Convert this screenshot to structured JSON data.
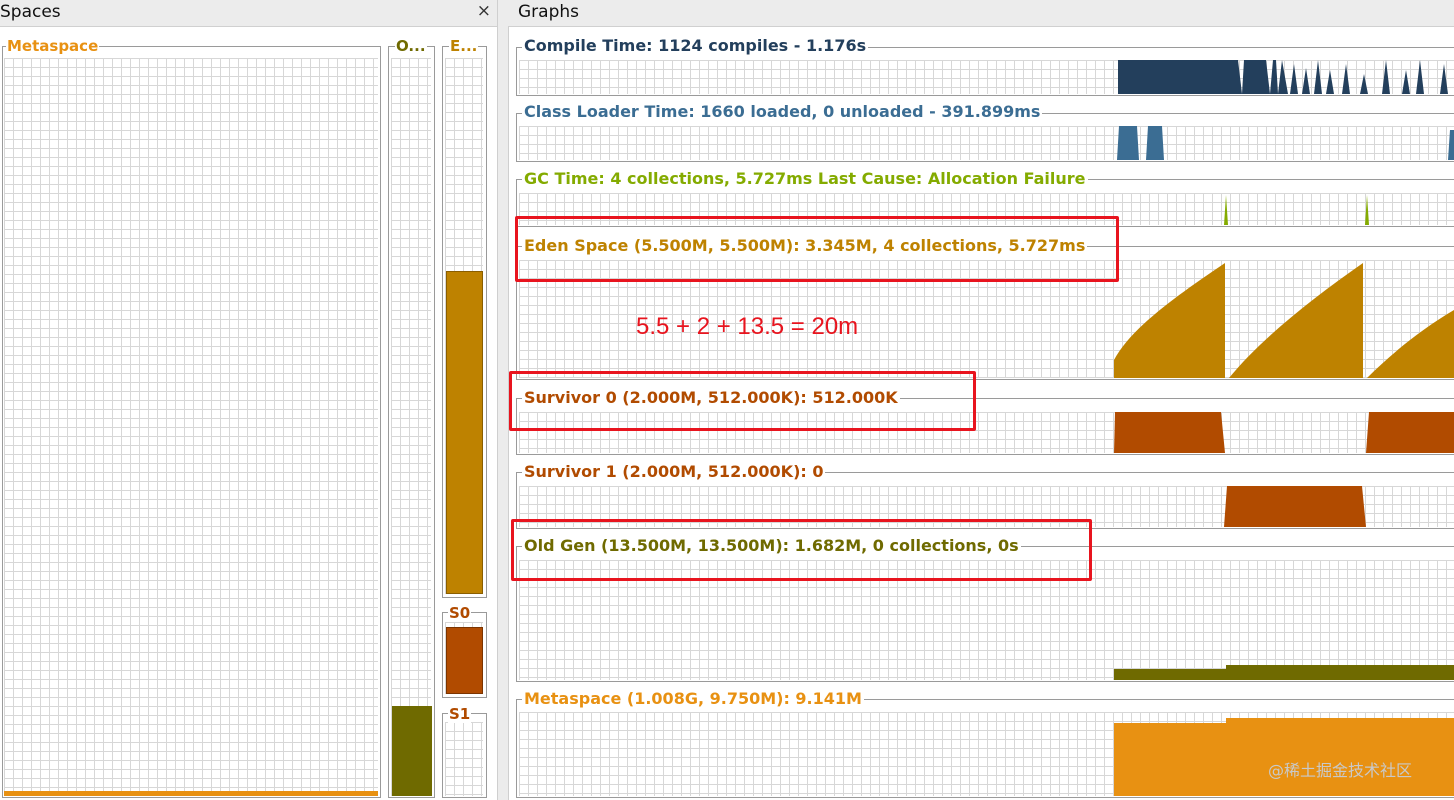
{
  "spaces": {
    "title": "Spaces",
    "close": "×",
    "metaspace": {
      "label": "Metaspace",
      "color": "#e89112",
      "used_fraction": 0.01
    },
    "old": {
      "label": "O...",
      "color": "#6f6a00",
      "used_fraction": 0.12
    },
    "eden": {
      "label": "E...",
      "color": "#be8200",
      "used_fraction": 0.61
    },
    "s0": {
      "label": "S0",
      "color": "#b14b00",
      "used_fraction": 1.0
    },
    "s1": {
      "label": "S1",
      "color": "#b14b00",
      "used_fraction": 0.0
    }
  },
  "graphs": {
    "title": "Graphs",
    "compile": {
      "label": "Compile Time: 1124 compiles - 1.176s",
      "color": "#233f5c"
    },
    "classloader": {
      "label": "Class Loader Time: 1660 loaded, 0 unloaded - 391.899ms",
      "color": "#3b6d93"
    },
    "gc": {
      "label": "GC Time: 4 collections, 5.727ms Last Cause: Allocation Failure",
      "color": "#84ab00"
    },
    "eden": {
      "label": "Eden Space (5.500M, 5.500M): 3.345M, 4 collections, 5.727ms",
      "color": "#be8200"
    },
    "survivor0": {
      "label": "Survivor 0 (2.000M, 512.000K): 512.000K",
      "color": "#b14b00"
    },
    "survivor1": {
      "label": "Survivor 1 (2.000M, 512.000K): 0",
      "color": "#b14b00"
    },
    "oldgen": {
      "label": "Old Gen (13.500M, 13.500M): 1.682M, 0 collections, 0s",
      "color": "#6f6a00"
    },
    "metaspace": {
      "label": "Metaspace (1.008G, 9.750M): 9.141M",
      "color": "#e89112"
    }
  },
  "annotation": {
    "text": "5.5 + 2 + 13.5 = 20m",
    "color": "#e8141e"
  },
  "watermark": "@稀土掘金技术社区"
}
